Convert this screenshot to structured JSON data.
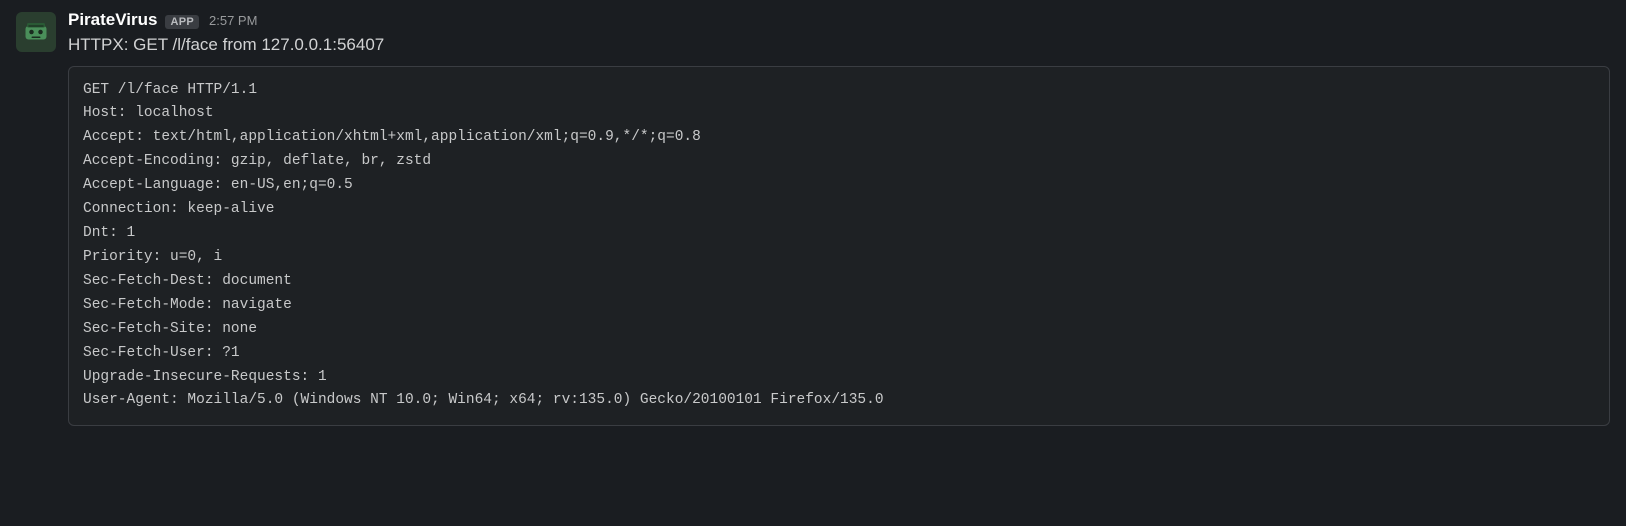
{
  "message": {
    "sender": "PirateVirus",
    "badge": "APP",
    "timestamp": "2:57 PM",
    "text": "HTTPX: GET /l/face from 127.0.0.1:56407",
    "code": "GET /l/face HTTP/1.1\nHost: localhost\nAccept: text/html,application/xhtml+xml,application/xml;q=0.9,*/*;q=0.8\nAccept-Encoding: gzip, deflate, br, zstd\nAccept-Language: en-US,en;q=0.5\nConnection: keep-alive\nDnt: 1\nPriority: u=0, i\nSec-Fetch-Dest: document\nSec-Fetch-Mode: navigate\nSec-Fetch-Site: none\nSec-Fetch-User: ?1\nUpgrade-Insecure-Requests: 1\nUser-Agent: Mozilla/5.0 (Windows NT 10.0; Win64; x64; rv:135.0) Gecko/20100101 Firefox/135.0"
  }
}
